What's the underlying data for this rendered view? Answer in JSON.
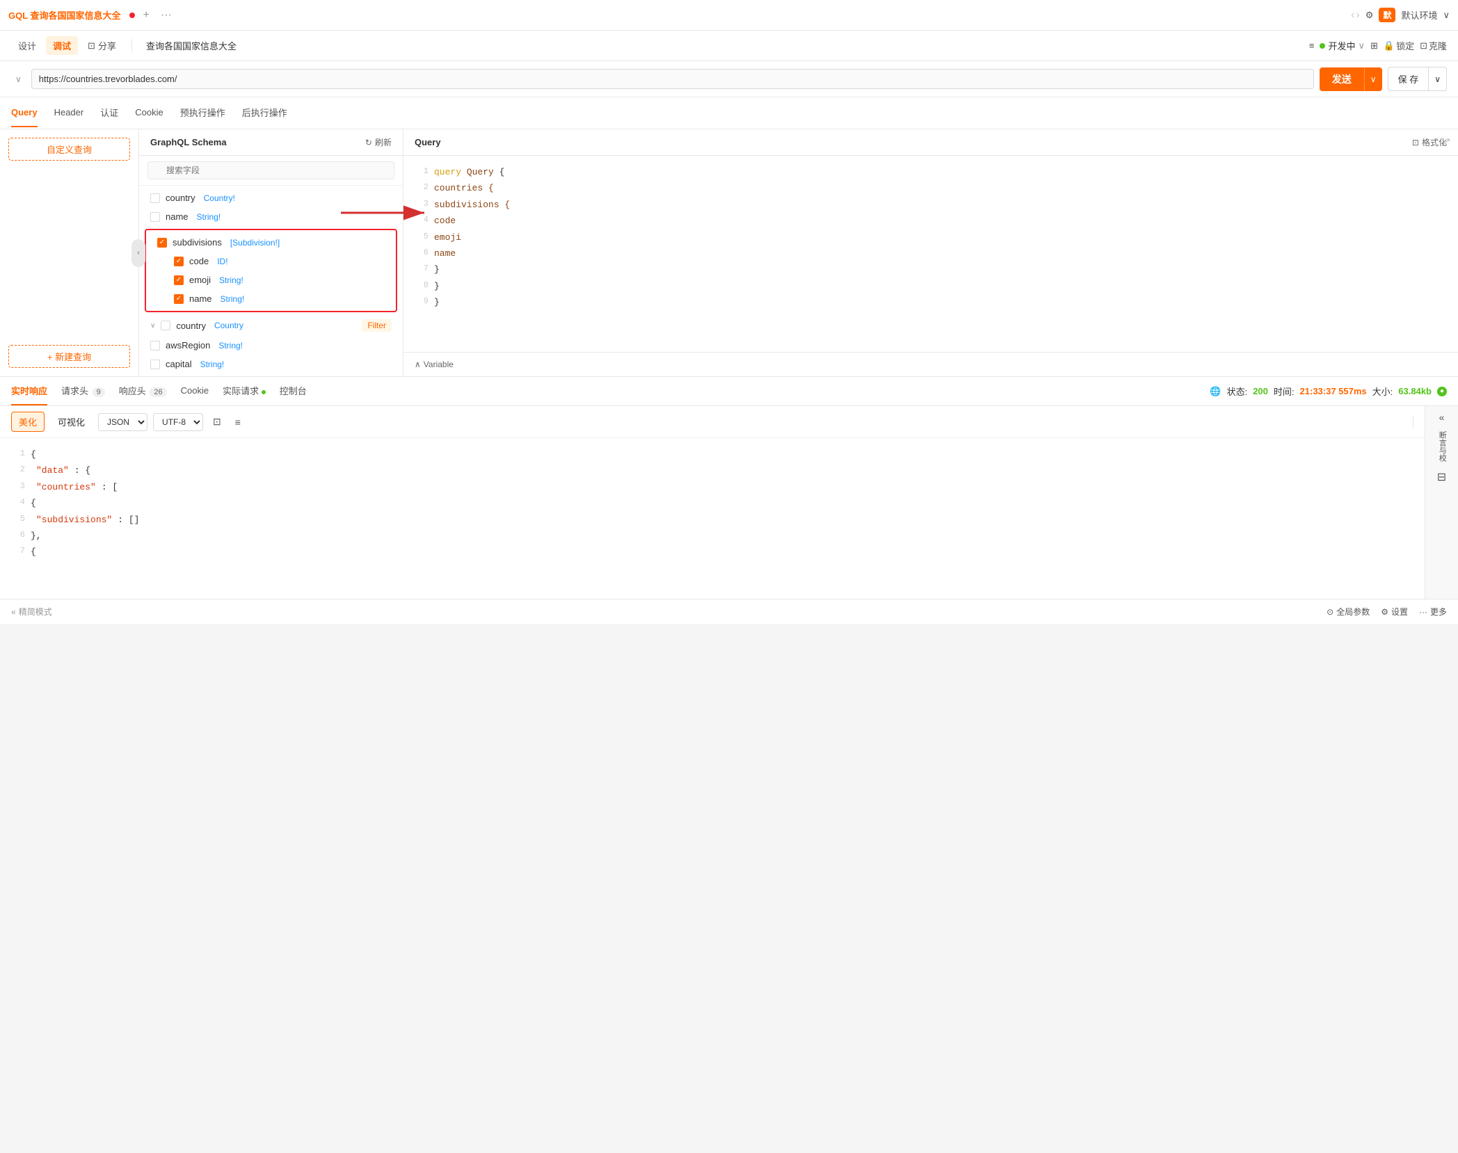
{
  "app": {
    "title": "GQL 查询各国国家信息大全",
    "dot_color": "#f5222d",
    "plus": "+",
    "ellipsis": "···"
  },
  "top_bar": {
    "nav_back": "‹",
    "nav_forward": "›",
    "settings_icon": "⚙",
    "env_prefix": "默",
    "env_label": "默认环境",
    "env_arrow": "∨"
  },
  "toolbar": {
    "design_label": "设计",
    "debug_label": "调试",
    "share_icon": "⊡",
    "share_label": "分享",
    "page_title": "查询各国国家信息大全",
    "filter_icon": "≡",
    "status_dot": "●",
    "status_label": "开发中",
    "status_arrow": "∨",
    "layout_icon": "⊞",
    "lock_icon": "🔒",
    "lock_label": "锁定",
    "clone_icon": "⊡",
    "clone_label": "克隆"
  },
  "url_bar": {
    "collapse_icon": "∨",
    "url": "https://countries.trevorblades.com/",
    "send_label": "发送",
    "send_arrow": "∨",
    "save_label": "保 存",
    "save_arrow": "∨"
  },
  "query_tabs": [
    {
      "id": "query",
      "label": "Query",
      "active": true
    },
    {
      "id": "header",
      "label": "Header"
    },
    {
      "id": "auth",
      "label": "认证"
    },
    {
      "id": "cookie",
      "label": "Cookie"
    },
    {
      "id": "pre_exec",
      "label": "预执行操作"
    },
    {
      "id": "post_exec",
      "label": "后执行操作"
    }
  ],
  "sidebar": {
    "title": "自定义查询",
    "new_query_label": "+ 新建查询"
  },
  "schema": {
    "title": "GraphQL Schema",
    "refresh_label": "刷新",
    "search_placeholder": "搜索字段",
    "items": [
      {
        "id": "country-field",
        "checked": false,
        "name": "country",
        "type": "Country!",
        "highlighted": false
      },
      {
        "id": "name-field",
        "checked": false,
        "name": "name",
        "type": "String!",
        "highlighted": false
      },
      {
        "id": "subdivisions-field",
        "checked": true,
        "name": "subdivisions",
        "type": "[Subdivision!]",
        "highlighted": true
      },
      {
        "id": "code-sub",
        "checked": true,
        "name": "code",
        "type": "ID!",
        "highlighted": true,
        "sub": true
      },
      {
        "id": "emoji-sub",
        "checked": true,
        "name": "emoji",
        "type": "String!",
        "highlighted": true,
        "sub": true
      },
      {
        "id": "name-sub",
        "checked": true,
        "name": "name",
        "type": "String!",
        "highlighted": true,
        "sub": true
      },
      {
        "id": "country-filter",
        "checked": false,
        "name": "country",
        "type": "Country",
        "hasFilter": true
      },
      {
        "id": "awsRegion-field",
        "checked": false,
        "name": "awsRegion",
        "type": "String!"
      },
      {
        "id": "capital-field",
        "checked": false,
        "name": "capital",
        "type": "String!"
      }
    ]
  },
  "query_editor": {
    "title": "Query",
    "format_label": "格式化",
    "expand_icon": "⤢",
    "lines": [
      {
        "num": 1,
        "content": "query Query {",
        "parts": [
          {
            "text": "query ",
            "class": "kw-query"
          },
          {
            "text": "Query",
            "class": "kw-field"
          },
          {
            "text": " {",
            "class": "code-content"
          }
        ]
      },
      {
        "num": 2,
        "content": "  countries {",
        "parts": [
          {
            "text": "    countries {",
            "class": "kw-field"
          }
        ]
      },
      {
        "num": 3,
        "content": "    subdivisions {",
        "parts": [
          {
            "text": "        subdivisions {",
            "class": "kw-field"
          }
        ]
      },
      {
        "num": 4,
        "content": "      code",
        "parts": [
          {
            "text": "            code",
            "class": "kw-field"
          }
        ]
      },
      {
        "num": 5,
        "content": "      emoji",
        "parts": [
          {
            "text": "            emoji",
            "class": "kw-field"
          }
        ]
      },
      {
        "num": 6,
        "content": "      name",
        "parts": [
          {
            "text": "            name",
            "class": "kw-field"
          }
        ]
      },
      {
        "num": 7,
        "content": "    }",
        "parts": [
          {
            "text": "        }",
            "class": "code-content"
          }
        ]
      },
      {
        "num": 8,
        "content": "  }",
        "parts": [
          {
            "text": "    }",
            "class": "code-content"
          }
        ]
      },
      {
        "num": 9,
        "content": "}",
        "parts": [
          {
            "text": "}",
            "class": "code-content"
          }
        ]
      }
    ],
    "variable_label": "Variable",
    "variable_icon": "∧"
  },
  "response": {
    "tabs": [
      {
        "id": "realtime",
        "label": "实时响应",
        "active": true,
        "badge": null
      },
      {
        "id": "request_headers",
        "label": "请求头",
        "badge": "9"
      },
      {
        "id": "response_headers",
        "label": "响应头",
        "badge": "26"
      },
      {
        "id": "cookie",
        "label": "Cookie"
      },
      {
        "id": "actual_request",
        "label": "实际请求",
        "dot": true
      },
      {
        "id": "console",
        "label": "控制台"
      }
    ],
    "status_globe": "🌐",
    "status_label": "状态:",
    "status_code": "200",
    "time_label": "时间:",
    "time_value": "21:33:37 557ms",
    "size_label": "大小:",
    "size_value": "63.84kb",
    "status_dot_green": "●",
    "format_buttons": [
      {
        "id": "beautify",
        "label": "美化",
        "active": true
      },
      {
        "id": "visualize",
        "label": "可视化"
      },
      {
        "id": "json",
        "label": "JSON"
      }
    ],
    "encoding_select": "UTF-8",
    "copy_icon": "⊡",
    "filter_icon": "≡",
    "json_lines": [
      {
        "num": 1,
        "content": "{"
      },
      {
        "num": 2,
        "content": "    \"data\": {",
        "key": "data"
      },
      {
        "num": 3,
        "content": "        \"countries\": [",
        "key": "countries"
      },
      {
        "num": 4,
        "content": "            {"
      },
      {
        "num": 5,
        "content": "                \"subdivisions\": []",
        "key": "subdivisions"
      },
      {
        "num": 6,
        "content": "            },"
      },
      {
        "num": 7,
        "content": "            {"
      }
    ],
    "right_panel": {
      "collapse_icon": "«",
      "break_label": "断言与校",
      "grid_icon": "⊟"
    }
  },
  "status_bar": {
    "simple_mode_icon": "«",
    "simple_mode_label": "精简模式",
    "global_params_icon": "⊙",
    "global_params_label": "全局参数",
    "settings_icon": "⚙",
    "settings_label": "设置",
    "more_icon": "···",
    "more_label": "更多"
  }
}
